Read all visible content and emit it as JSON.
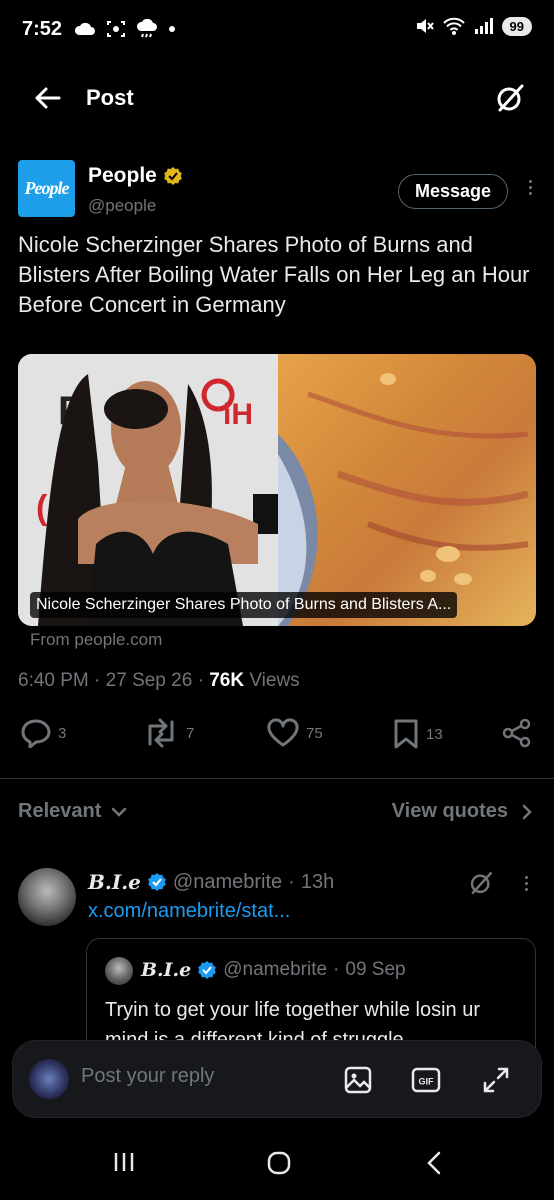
{
  "status_bar": {
    "time": "7:52",
    "battery": "99"
  },
  "header": {
    "title": "Post"
  },
  "post": {
    "author_name": "People",
    "author_handle": "@people",
    "logo_text": "People",
    "message_label": "Message",
    "text": "Nicole Scherzinger Shares Photo of Burns and Blisters After Boiling Water Falls on Her Leg an Hour Before Concert in Germany",
    "card_caption": "Nicole Scherzinger Shares Photo of Burns and Blisters A...",
    "card_source": "From people.com",
    "time": "6:40 PM",
    "date": "27 Sep 26",
    "views_count": "76K",
    "views_label": "Views",
    "sep": "·"
  },
  "actions": {
    "replies": "3",
    "reposts": "7",
    "likes": "75",
    "bookmarks": "13"
  },
  "filter": {
    "relevant_label": "Relevant",
    "view_quotes_label": "View quotes"
  },
  "reply": {
    "name": "B.I.e",
    "handle": "@namebrite",
    "time": "13h",
    "link": "x.com/namebrite/stat...",
    "quote": {
      "name": "B.I.e",
      "handle": "@namebrite",
      "date": "09 Sep",
      "text": "Tryin to get your life together while losin ur mind is a different kind of struggle"
    }
  },
  "reply_bar": {
    "placeholder": "Post your reply",
    "gif_label": "GIF"
  },
  "colors": {
    "accent": "#1d9bf0",
    "verified_gold": "#e2b719",
    "muted": "#71767b"
  }
}
